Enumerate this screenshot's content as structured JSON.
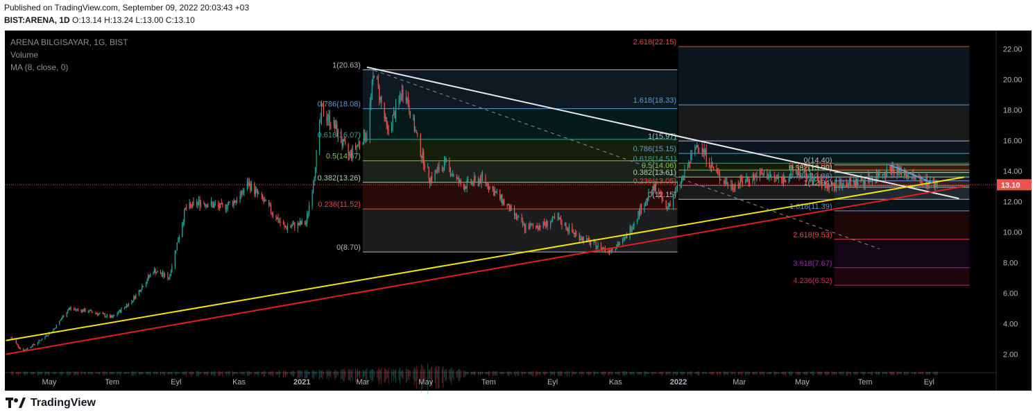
{
  "header": {
    "published": "Published on TradingView.com, September 09, 2022 20:03:43 +03",
    "symbol": "BIST:ARENA, 1D",
    "ohlc": "O:13.14 H:13.24 L:13.00 C:13.10"
  },
  "legend": {
    "title": "ARENA BILGISAYAR, 1G, BIST",
    "volume": "Volume",
    "ma": "MA (8, close, 0)"
  },
  "footer": {
    "brand": "TradingView"
  },
  "chart_data": {
    "type": "candlestick",
    "ylim": [
      0.8,
      23.2
    ],
    "y_ticks": [
      "2.00",
      "4.00",
      "6.00",
      "8.00",
      "10.00",
      "12.00",
      "14.00",
      "16.00",
      "18.00",
      "20.00",
      "22.00"
    ],
    "x_ticks": [
      "May",
      "Tem",
      "Eyl",
      "Kas",
      "2021",
      "Mar",
      "May",
      "Tem",
      "Eyl",
      "Kas",
      "2022",
      "Mar",
      "May",
      "Tem",
      "Eyl"
    ],
    "last_price": "13.10",
    "price_path": [
      [
        "2020-03-25",
        3.1
      ],
      [
        "2020-04-05",
        2.2
      ],
      [
        "2020-04-20",
        2.8
      ],
      [
        "2020-05-05",
        3.6
      ],
      [
        "2020-05-20",
        5.0
      ],
      [
        "2020-06-10",
        4.8
      ],
      [
        "2020-07-01",
        4.4
      ],
      [
        "2020-07-20",
        5.5
      ],
      [
        "2020-08-10",
        7.5
      ],
      [
        "2020-08-25",
        7.0
      ],
      [
        "2020-09-10",
        11.5
      ],
      [
        "2020-09-25",
        12.0
      ],
      [
        "2020-10-15",
        11.6
      ],
      [
        "2020-11-01",
        12.2
      ],
      [
        "2020-11-10",
        13.2
      ],
      [
        "2020-11-25",
        12.0
      ],
      [
        "2020-12-15",
        10.3
      ],
      [
        "2021-01-05",
        10.6
      ],
      [
        "2021-01-12",
        13.3
      ],
      [
        "2021-01-20",
        18.0
      ],
      [
        "2021-02-01",
        17.0
      ],
      [
        "2021-02-15",
        15.0
      ],
      [
        "2021-03-05",
        16.5
      ],
      [
        "2021-03-12",
        20.6
      ],
      [
        "2021-03-25",
        16.5
      ],
      [
        "2021-04-10",
        19.5
      ],
      [
        "2021-04-25",
        15.5
      ],
      [
        "2021-05-05",
        13.5
      ],
      [
        "2021-05-20",
        14.5
      ],
      [
        "2021-06-05",
        13.0
      ],
      [
        "2021-06-25",
        13.5
      ],
      [
        "2021-07-15",
        12.0
      ],
      [
        "2021-08-05",
        10.3
      ],
      [
        "2021-08-25",
        10.5
      ],
      [
        "2021-09-05",
        10.9
      ],
      [
        "2021-09-20",
        10.0
      ],
      [
        "2021-10-10",
        9.2
      ],
      [
        "2021-10-25",
        8.8
      ],
      [
        "2021-11-10",
        9.5
      ],
      [
        "2021-11-25",
        11.5
      ],
      [
        "2021-12-10",
        13.0
      ],
      [
        "2021-12-20",
        11.5
      ],
      [
        "2022-01-05",
        13.5
      ],
      [
        "2022-01-20",
        15.9
      ],
      [
        "2022-02-05",
        14.0
      ],
      [
        "2022-02-20",
        13.0
      ],
      [
        "2022-03-10",
        13.5
      ],
      [
        "2022-03-25",
        13.8
      ],
      [
        "2022-04-10",
        13.4
      ],
      [
        "2022-04-25",
        14.0
      ],
      [
        "2022-05-10",
        13.5
      ],
      [
        "2022-05-25",
        13.0
      ],
      [
        "2022-06-10",
        13.2
      ],
      [
        "2022-06-25",
        13.3
      ],
      [
        "2022-07-10",
        13.6
      ],
      [
        "2022-07-25",
        14.2
      ],
      [
        "2022-08-10",
        13.8
      ],
      [
        "2022-08-25",
        13.4
      ],
      [
        "2022-09-09",
        13.1
      ]
    ],
    "volume_path": [
      [
        "2020-09-10",
        1.0
      ],
      [
        "2020-11-10",
        0.8
      ],
      [
        "2021-01-20",
        1.6
      ],
      [
        "2021-03-12",
        2.9
      ],
      [
        "2021-04-10",
        2.5
      ],
      [
        "2021-05-05",
        5.8
      ],
      [
        "2021-06-10",
        0.9
      ],
      [
        "2021-11-25",
        0.8
      ],
      [
        "2022-01-20",
        0.7
      ]
    ],
    "trendlines": [
      {
        "name": "resistance",
        "color": "#e8e8e8",
        "from": [
          "2021-03-05",
          20.8
        ],
        "to": [
          "2022-09-30",
          12.2
        ]
      },
      {
        "name": "support-1",
        "color": "#f5e300",
        "from": [
          "2020-03-20",
          2.9
        ],
        "to": [
          "2022-10-05",
          13.6
        ]
      },
      {
        "name": "support-2",
        "color": "#e51d1d",
        "from": [
          "2020-03-20",
          2.0
        ],
        "to": [
          "2022-10-05",
          13.0
        ]
      },
      {
        "name": "channel-dashed",
        "color": "#8a8e99",
        "from": [
          "2021-03-12",
          20.6
        ],
        "to": [
          "2022-07-15",
          8.9
        ]
      },
      {
        "name": "short-down",
        "color": "#5b9bd5",
        "from": [
          "2022-07-25",
          14.4
        ],
        "to": [
          "2022-09-05",
          13.2
        ]
      }
    ],
    "fib_retracement_1": {
      "from": "2021-03-01",
      "to": "2021-12-31",
      "levels": [
        {
          "label": "1(20.63)",
          "value": 20.63,
          "color": "#b2b5be"
        },
        {
          "label": "0.786(18.08)",
          "value": 18.08,
          "color": "#5b9bd5"
        },
        {
          "label": "0.618(16.07)",
          "value": 16.07,
          "color": "#26a69a"
        },
        {
          "label": "0.5(14.67)",
          "value": 14.67,
          "color": "#8bc34a"
        },
        {
          "label": "0.382(13.26)",
          "value": 13.26,
          "color": "#a5d6a7"
        },
        {
          "label": "0.236(11.52)",
          "value": 11.52,
          "color": "#f44336"
        },
        {
          "label": "0(8.70)",
          "value": 8.7,
          "color": "#b2b5be"
        }
      ]
    },
    "fib_extension": {
      "from": "2022-01-01",
      "to": "2022-10-10",
      "levels": [
        {
          "label": "2.618(22.15)",
          "value": 22.15,
          "color": "#f44336"
        },
        {
          "label": "1.618(18.33)",
          "value": 18.33,
          "color": "#5b9bd5"
        },
        {
          "label": "1(15.97)",
          "value": 15.97,
          "color": "#b2b5be"
        },
        {
          "label": "0.786(15.15)",
          "value": 15.15,
          "color": "#5b9bd5"
        },
        {
          "label": "0.618(14.51)",
          "value": 14.51,
          "color": "#26a69a"
        },
        {
          "label": "0.5(14.06)",
          "value": 14.06,
          "color": "#8bc34a"
        },
        {
          "label": "0.382(13.61)",
          "value": 13.61,
          "color": "#a5d6a7"
        },
        {
          "label": "0.236(13.05)",
          "value": 13.05,
          "color": "#f44336"
        },
        {
          "label": "0(12.15)",
          "value": 12.15,
          "color": "#b2b5be"
        }
      ]
    },
    "fib_extension_2": {
      "from": "2022-06-01",
      "to": "2022-10-10",
      "levels": [
        {
          "label": "0(14.40)",
          "value": 14.4,
          "color": "#b2b5be"
        },
        {
          "label": "0.236(14.06)",
          "value": 14.06,
          "color": "#f44336"
        },
        {
          "label": "0.382(13.90)",
          "value": 13.9,
          "color": "#a5d6a7"
        },
        {
          "label": "0.786(13.36)",
          "value": 13.36,
          "color": "#5b9bd5"
        },
        {
          "label": "1(12.94)",
          "value": 12.94,
          "color": "#b2b5be"
        },
        {
          "label": "1.618(11.39)",
          "value": 11.39,
          "color": "#5b9bd5"
        },
        {
          "label": "2.618(9.53)",
          "value": 9.53,
          "color": "#f44336"
        },
        {
          "label": "3.618(7.67)",
          "value": 7.67,
          "color": "#9c27b0"
        },
        {
          "label": "4.236(6.52)",
          "value": 6.52,
          "color": "#e91e63"
        }
      ]
    }
  }
}
